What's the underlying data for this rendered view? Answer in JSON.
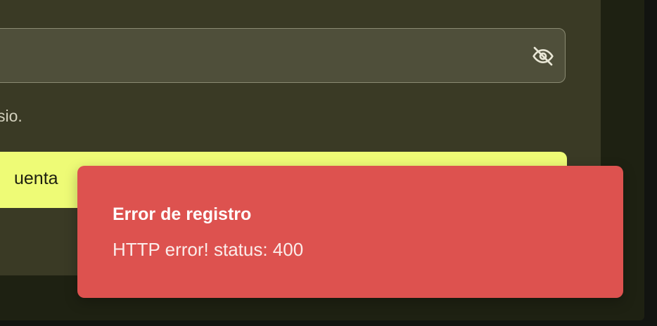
{
  "form": {
    "password_toggle_icon": "eye-off-icon",
    "hint_text": "sio.",
    "submit_label": "uenta"
  },
  "toast": {
    "title": "Error de registro",
    "description": "HTTP error! status: 400"
  },
  "colors": {
    "card_bg": "#3a3a25",
    "input_bg": "#4f4f3a",
    "accent": "#eefb76",
    "error": "#dd524f"
  }
}
